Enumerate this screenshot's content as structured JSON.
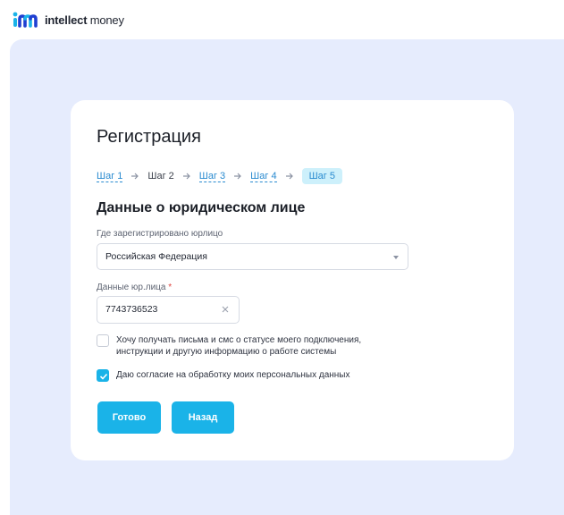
{
  "brand": {
    "name_bold": "intellect",
    "name_regular": " money",
    "logo_icon": "im-logo-icon"
  },
  "form": {
    "title": "Регистрация",
    "steps": [
      {
        "label": "Шаг 1",
        "state": "link"
      },
      {
        "label": "Шаг 2",
        "state": "plain"
      },
      {
        "label": "Шаг 3",
        "state": "link"
      },
      {
        "label": "Шаг 4",
        "state": "link"
      },
      {
        "label": "Шаг 5",
        "state": "active"
      }
    ],
    "section_title": "Данные о юридическом лице",
    "country": {
      "label": "Где зарегистрировано юрлицо",
      "value": "Российская Федерация"
    },
    "entity": {
      "label": "Данные юр.лица",
      "required_mark": "*",
      "value": "7743736523"
    },
    "consents": [
      {
        "text": "Хочу получать письма и смс о статусе моего подключения, инструкции и другую информацию о работе системы",
        "checked": false
      },
      {
        "text": "Даю согласие на обработку моих персональных данных",
        "checked": true
      }
    ],
    "buttons": {
      "done": "Готово",
      "back": "Назад"
    }
  },
  "colors": {
    "accent": "#1ab3e8",
    "link": "#2a8bd0",
    "page_bg": "#e6ecfd"
  }
}
